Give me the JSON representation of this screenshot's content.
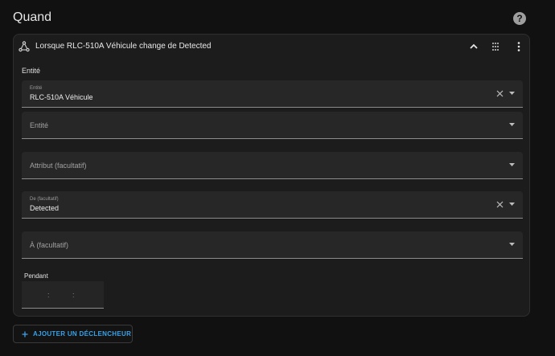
{
  "section": {
    "title": "Quand"
  },
  "icons": {
    "help": "help-circle-icon",
    "trigger": "state-change-icon",
    "collapse": "chevron-up-icon",
    "drag": "drag-handle-icon",
    "menu": "dots-vertical-icon",
    "clear": "close-icon",
    "dropdown": "dropdown-arrow-icon",
    "add": "plus-icon"
  },
  "card": {
    "title": "Lorsque RLC-510A Véhicule change de Detected",
    "group_label": "Entité",
    "fields": {
      "entity": {
        "label": "Entité",
        "value": "RLC-510A Véhicule"
      },
      "entity_empty": {
        "placeholder": "Entité"
      },
      "attribute": {
        "placeholder": "Attribut (facultatif)"
      },
      "from": {
        "label": "De (facultatif)",
        "value": "Detected"
      },
      "to": {
        "placeholder": "À (facultatif)"
      }
    },
    "duration": {
      "label": "Pendant",
      "sep1": ":",
      "sep2": ":"
    }
  },
  "add_trigger": {
    "label": "AJOUTER UN DÉCLENCHEUR"
  },
  "colors": {
    "background": "#111111",
    "card": "#1c1c1c",
    "field": "#272727",
    "accent": "#3aa1e6"
  }
}
